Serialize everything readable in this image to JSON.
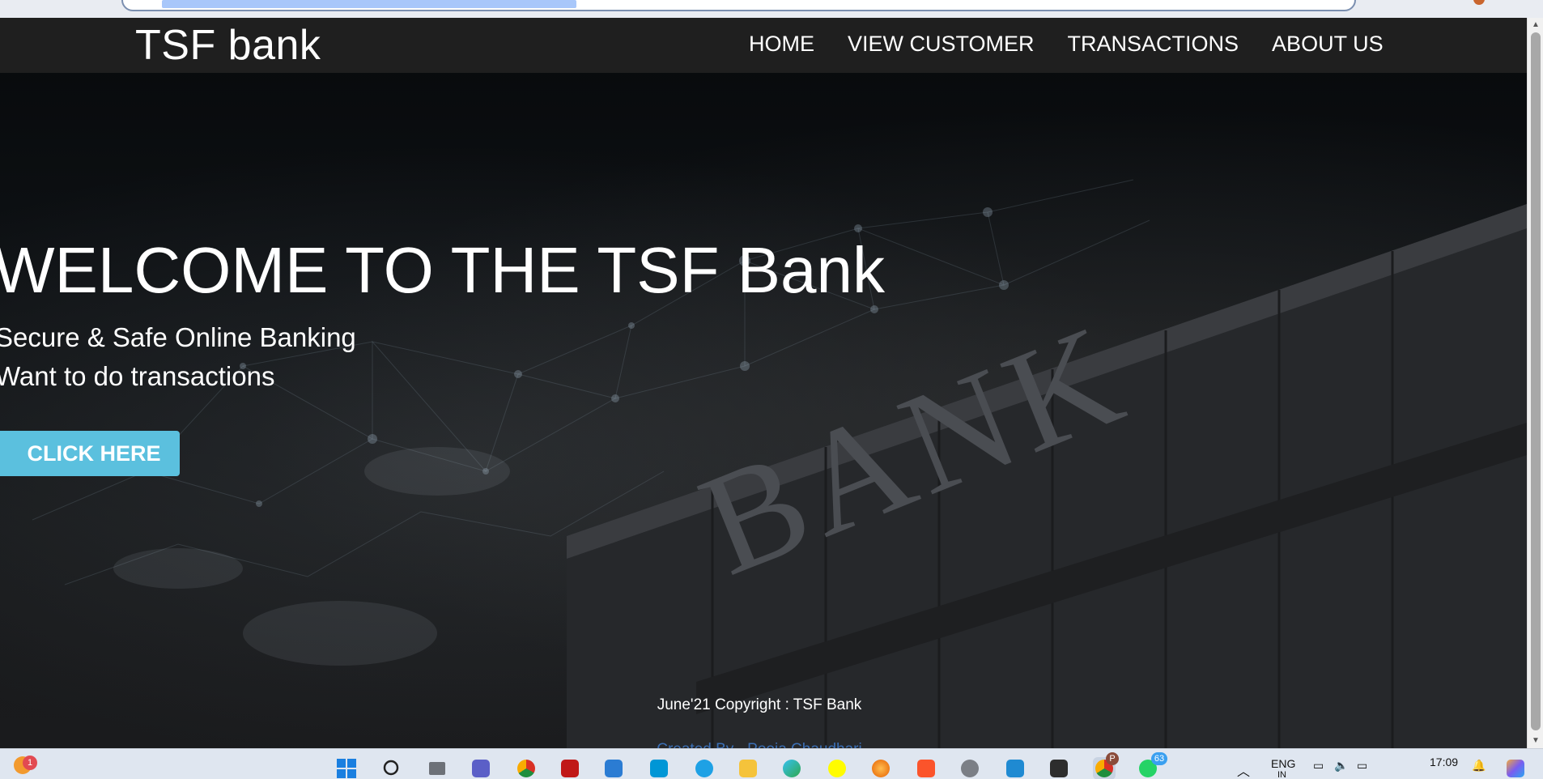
{
  "browser": {
    "address_text": ""
  },
  "navbar": {
    "brand": "TSF bank",
    "links": [
      {
        "label": "HOME"
      },
      {
        "label": "VIEW CUSTOMER"
      },
      {
        "label": "TRANSACTIONS"
      },
      {
        "label": "ABOUT US"
      }
    ]
  },
  "hero": {
    "title": "WELCOME TO THE TSF Bank",
    "subtitle_1": "Secure & Safe Online Banking",
    "subtitle_2": "Want to do transactions",
    "cta_label": "CLICK HERE",
    "background_sign": "BANK"
  },
  "footer": {
    "copyright": "June'21 Copyright : TSF Bank",
    "created_by": "Created By - Pooja Chaudhari"
  },
  "taskbar": {
    "left_badge": "1",
    "teams_icon": "teams-icon",
    "whatsapp_badge": "63",
    "chrome_profile_badge": "P",
    "language": "ENG",
    "language_region": "IN",
    "time": "17:09",
    "date": "",
    "colors": {
      "windows_blue": "#1a7fe0",
      "chrome_red": "#d93025",
      "vscode_blue": "#1f8ad2"
    }
  },
  "colors": {
    "navbar_bg": "#1f1f1f",
    "cta_bg": "#5bc0de",
    "footer_link": "#3b6fb5"
  }
}
